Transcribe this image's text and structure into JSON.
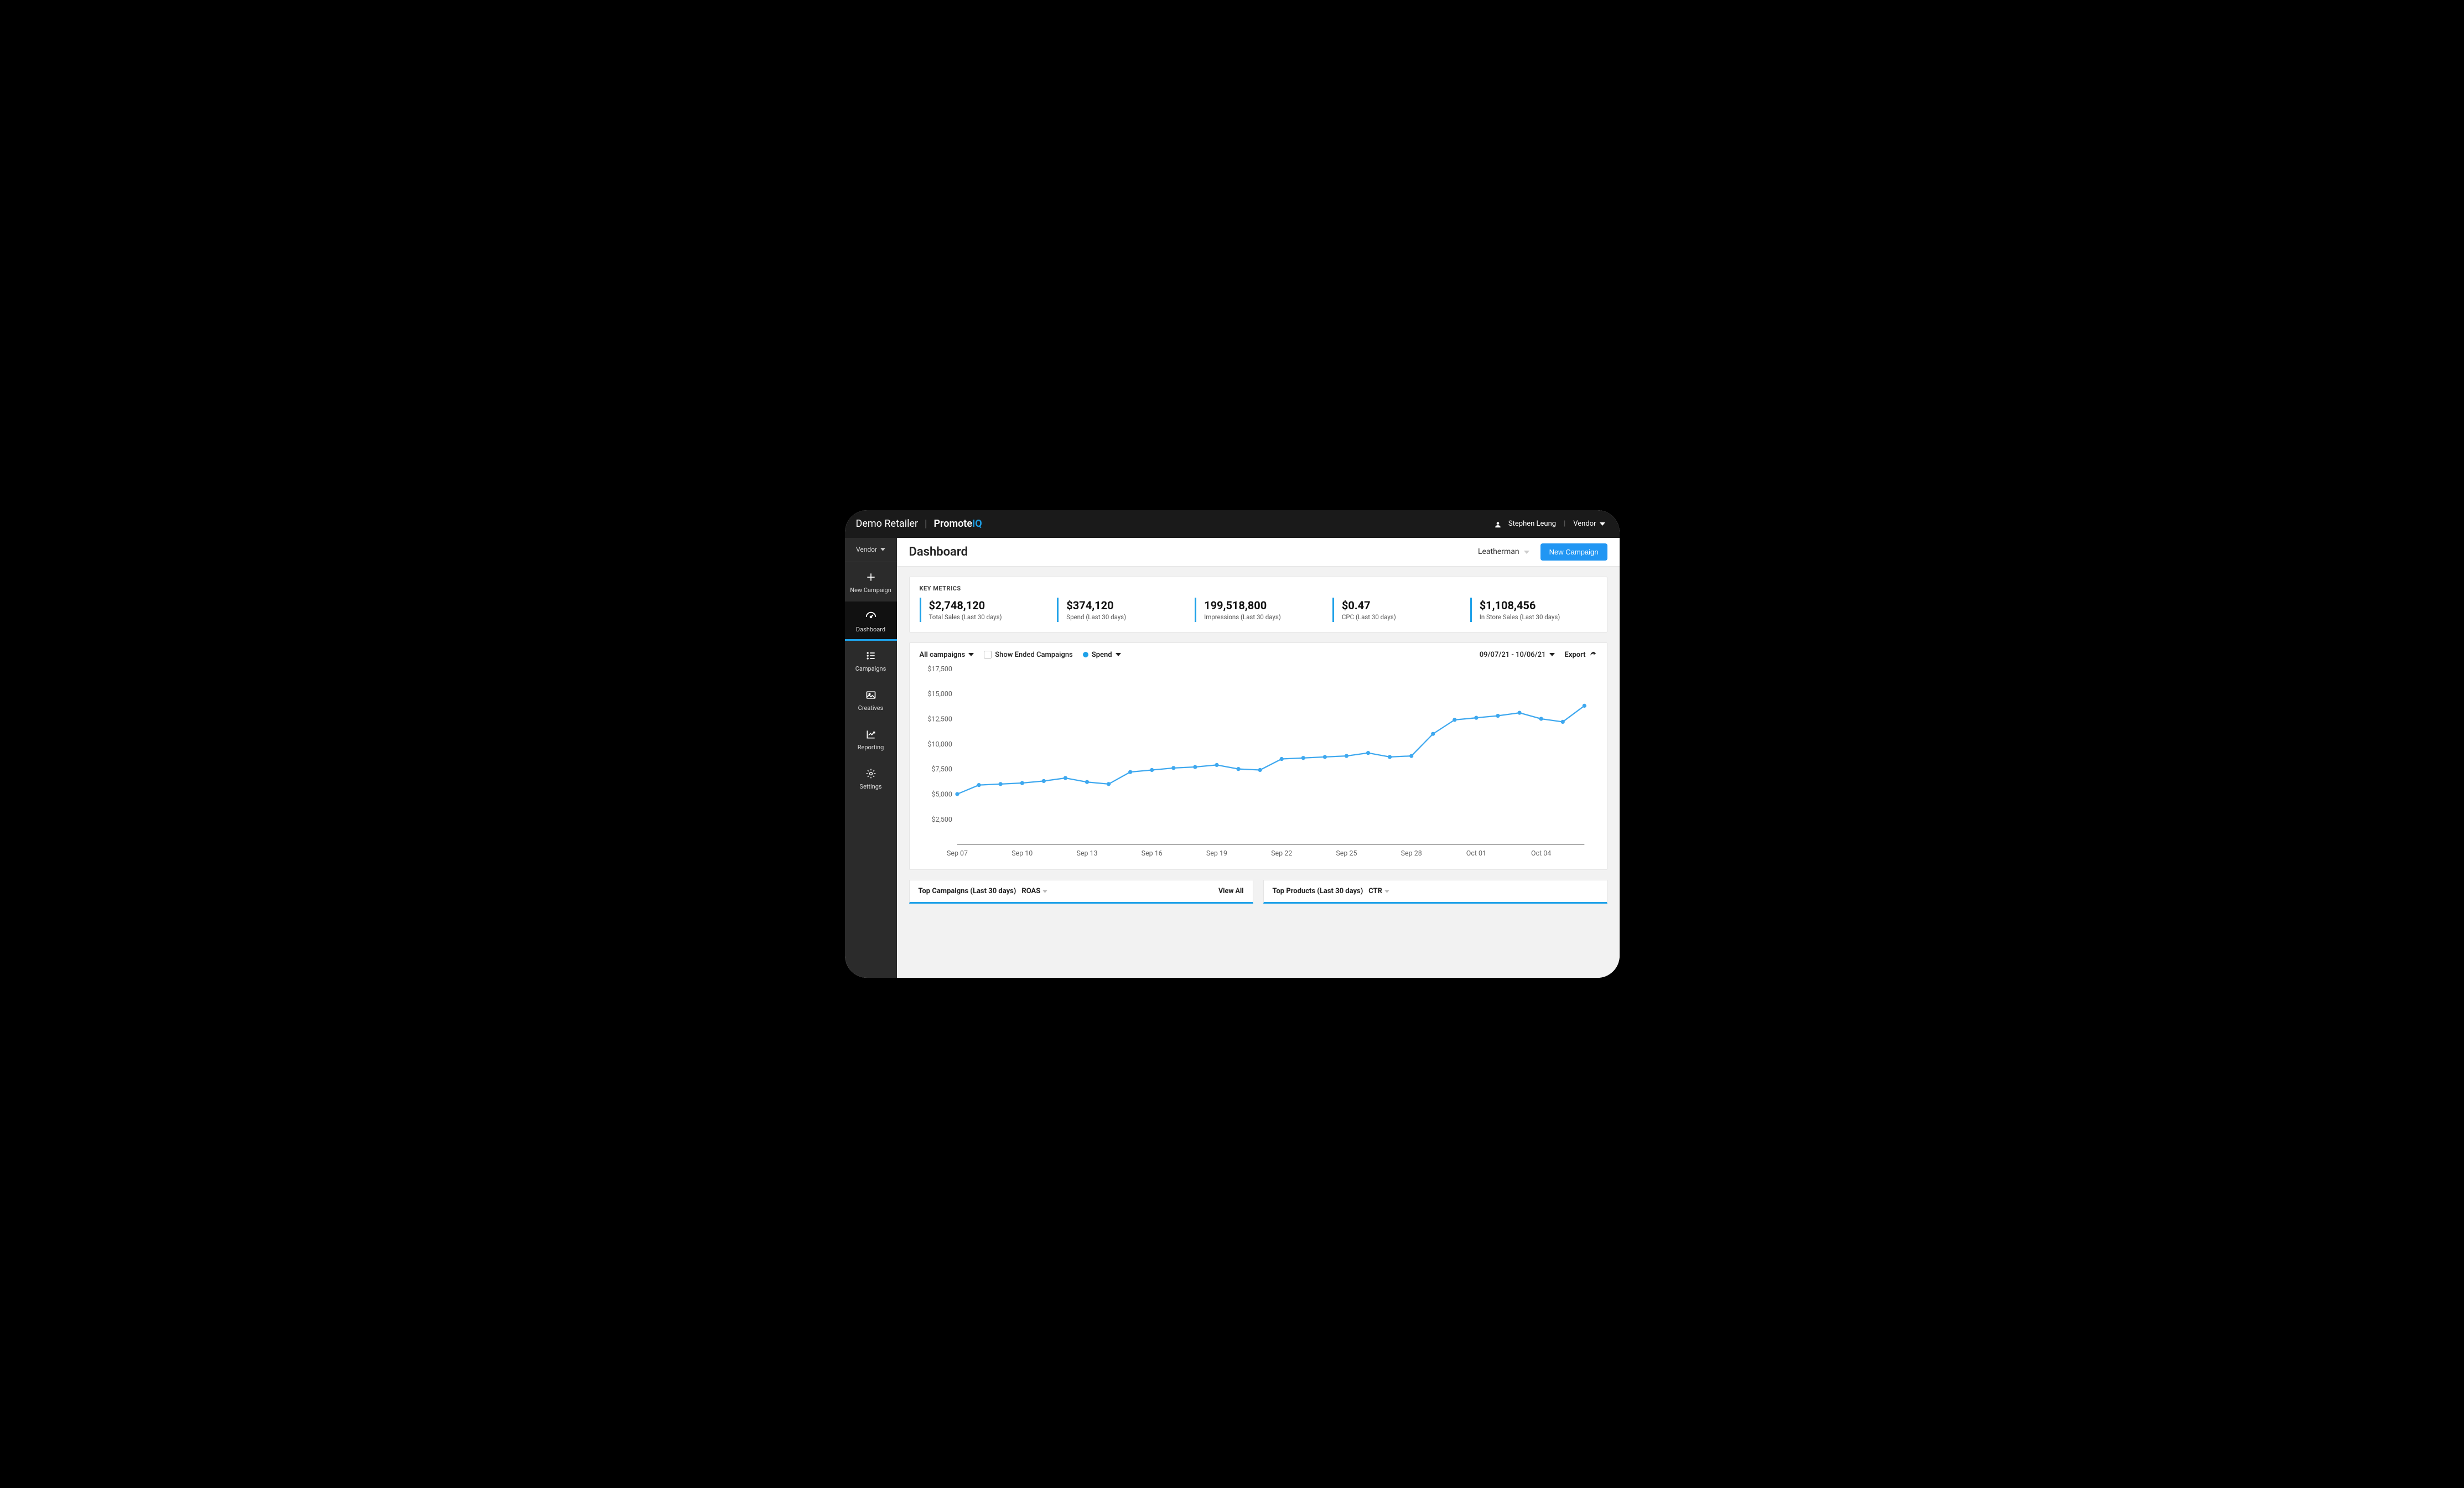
{
  "topbar": {
    "retailer": "Demo Retailer",
    "product_prefix": "Promote",
    "product_suffix": "IQ",
    "user_name": "Stephen Leung",
    "role_label": "Vendor"
  },
  "sidebar": {
    "vendor_label": "Vendor",
    "items": [
      {
        "id": "new-campaign",
        "label": "New Campaign",
        "icon": "plus"
      },
      {
        "id": "dashboard",
        "label": "Dashboard",
        "icon": "gauge",
        "active": true
      },
      {
        "id": "campaigns",
        "label": "Campaigns",
        "icon": "list"
      },
      {
        "id": "creatives",
        "label": "Creatives",
        "icon": "image"
      },
      {
        "id": "reporting",
        "label": "Reporting",
        "icon": "chart"
      },
      {
        "id": "settings",
        "label": "Settings",
        "icon": "gear"
      }
    ]
  },
  "page": {
    "title": "Dashboard",
    "brand_selected": "Leatherman",
    "new_campaign_btn": "New Campaign"
  },
  "metrics": {
    "section_title": "KEY METRICS",
    "items": [
      {
        "value": "$2,748,120",
        "label": "Total Sales (Last 30 days)"
      },
      {
        "value": "$374,120",
        "label": "Spend (Last 30 days)"
      },
      {
        "value": "199,518,800",
        "label": "Impressions (Last 30 days)"
      },
      {
        "value": "$0.47",
        "label": "CPC (Last 30 days)"
      },
      {
        "value": "$1,108,456",
        "label": "In Store Sales (Last 30 days)"
      }
    ]
  },
  "chart": {
    "campaign_filter": "All campaigns",
    "show_ended_label": "Show Ended Campaigns",
    "metric_selected": "Spend",
    "date_range": "09/07/21 - 10/06/21",
    "export_label": "Export"
  },
  "chart_data": {
    "type": "line",
    "ylabel": "",
    "xlabel": "",
    "ylim": [
      0,
      17500
    ],
    "y_ticks": [
      2500,
      5000,
      7500,
      10000,
      12500,
      15000,
      17500
    ],
    "y_tick_labels": [
      "$2,500",
      "$5,000",
      "$7,500",
      "$10,000",
      "$12,500",
      "$15,000",
      "$17,500"
    ],
    "x_tick_every": 3,
    "x_tick_labels": [
      "Sep 07",
      "Sep 10",
      "Sep 13",
      "Sep 16",
      "Sep 19",
      "Sep 22",
      "Sep 25",
      "Sep 28",
      "Oct 01",
      "Oct 04"
    ],
    "categories": [
      "Sep 07",
      "Sep 08",
      "Sep 09",
      "Sep 10",
      "Sep 11",
      "Sep 12",
      "Sep 13",
      "Sep 14",
      "Sep 15",
      "Sep 16",
      "Sep 17",
      "Sep 18",
      "Sep 19",
      "Sep 20",
      "Sep 21",
      "Sep 22",
      "Sep 23",
      "Sep 24",
      "Sep 25",
      "Sep 26",
      "Sep 27",
      "Sep 28",
      "Sep 29",
      "Sep 30",
      "Oct 01",
      "Oct 02",
      "Oct 03",
      "Oct 04",
      "Oct 05",
      "Oct 06"
    ],
    "series": [
      {
        "name": "Spend",
        "color": "#3ea8ef",
        "values": [
          5000,
          5900,
          6000,
          6100,
          6300,
          6600,
          6200,
          6000,
          7200,
          7400,
          7600,
          7700,
          7900,
          7500,
          7400,
          8500,
          8600,
          8700,
          8800,
          9100,
          8700,
          8800,
          11000,
          12400,
          12600,
          12800,
          13100,
          12500,
          12200,
          13800
        ]
      }
    ]
  },
  "bottom": {
    "campaigns_title": "Top Campaigns (Last 30 days)",
    "campaigns_metric": "ROAS",
    "view_all": "View All",
    "products_title": "Top Products (Last 30 days)",
    "products_metric": "CTR"
  }
}
